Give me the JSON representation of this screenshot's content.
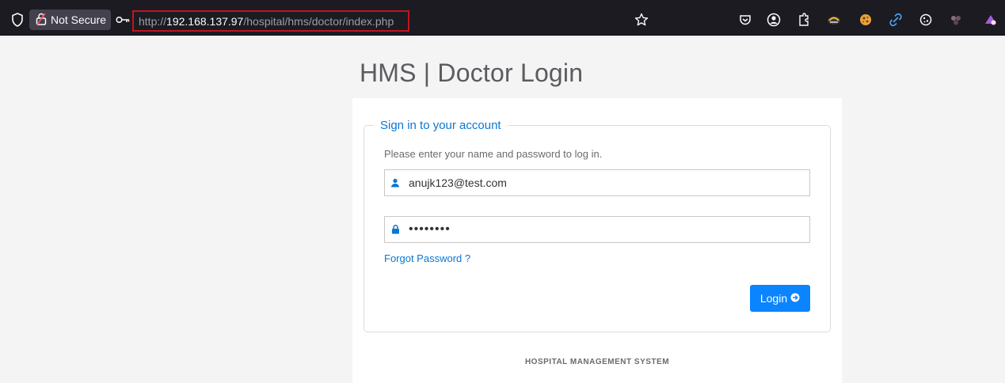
{
  "browser": {
    "security_label": "Not Secure",
    "url": {
      "scheme": "http://",
      "host": "192.168.137.97",
      "path": "/hospital/hms/doctor/index.php"
    },
    "icons": [
      "shield-icon",
      "lock-broken-icon",
      "key-icon",
      "bookmark-star-icon",
      "pocket-icon",
      "account-icon",
      "extensions-icon",
      "extension-icons"
    ]
  },
  "page": {
    "title": "HMS | Doctor Login",
    "login": {
      "legend": "Sign in to your account",
      "intro": "Please enter your name and password to log in.",
      "username_value": "anujk123@test.com",
      "password_value": "••••••••",
      "forgot_label": "Forgot Password ?",
      "button_label": "Login"
    },
    "footer": "HOSPITAL MANAGEMENT SYSTEM"
  },
  "colors": {
    "accent": "#0a77d3",
    "button": "#0b84ff",
    "url_highlight": "#c0151b",
    "toolbar": "#1c1b22"
  }
}
